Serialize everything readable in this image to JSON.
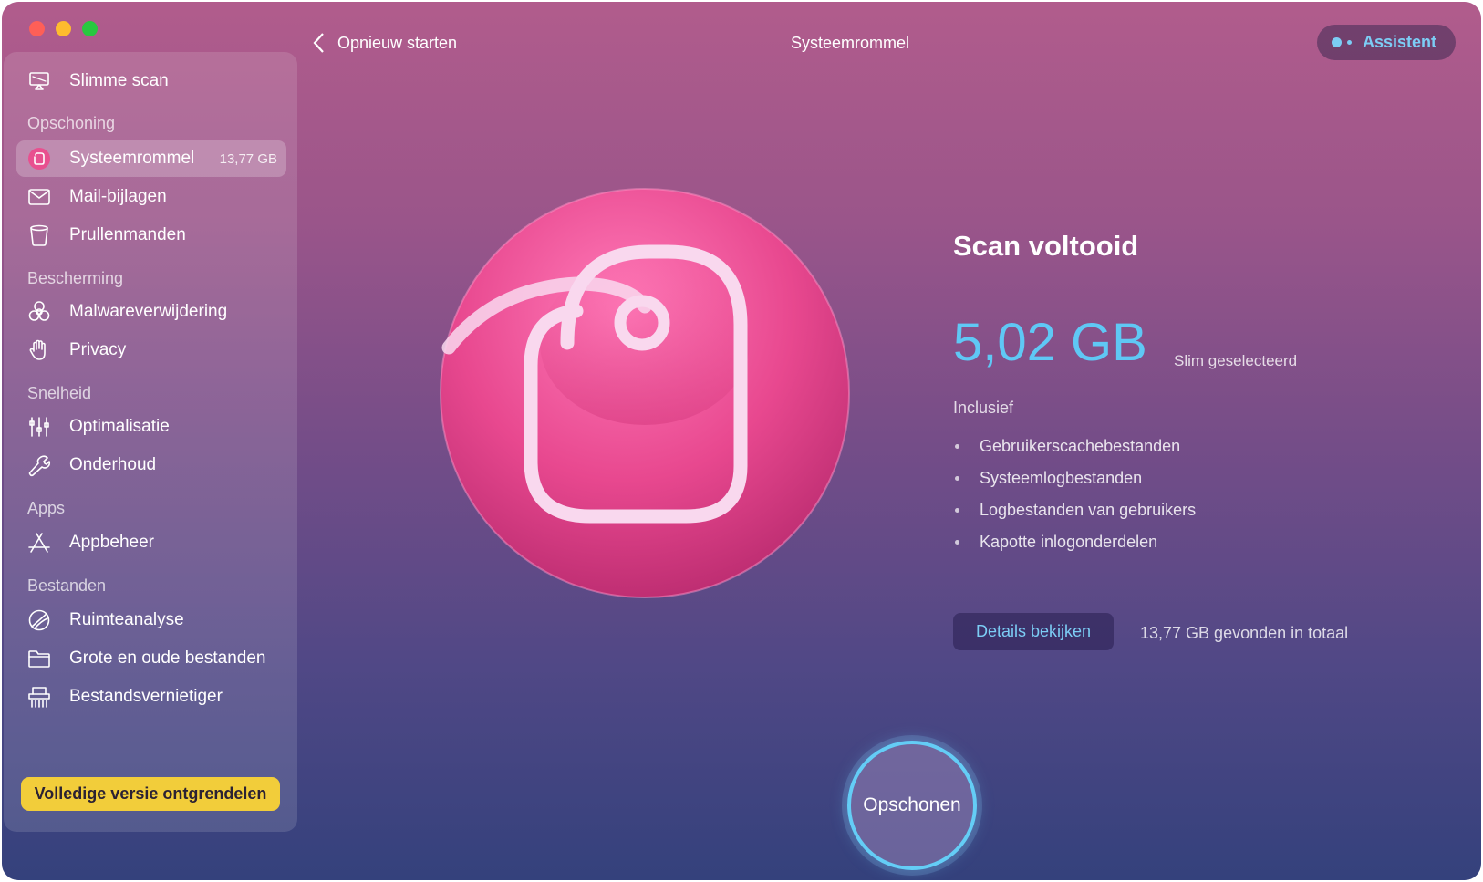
{
  "window": {
    "traffic_lights": [
      "close",
      "minimize",
      "zoom"
    ]
  },
  "topbar": {
    "back_label": "Opnieuw starten",
    "title": "Systeemrommel",
    "assistant_label": "Assistent"
  },
  "sidebar": {
    "smart_scan": "Slimme scan",
    "sections": {
      "cleanup": "Opschoning",
      "protection": "Bescherming",
      "speed": "Snelheid",
      "apps": "Apps",
      "files": "Bestanden"
    },
    "items": {
      "system_junk": {
        "label": "Systeemrommel",
        "size": "13,77 GB"
      },
      "mail_attachments": "Mail-bijlagen",
      "trash_bins": "Prullenmanden",
      "malware_removal": "Malwareverwijdering",
      "privacy": "Privacy",
      "optimization": "Optimalisatie",
      "maintenance": "Onderhoud",
      "app_manager": "Appbeheer",
      "space_lens": "Ruimteanalyse",
      "large_old_files": "Grote en oude bestanden",
      "shredder": "Bestandsvernietiger"
    },
    "unlock_label": "Volledige versie ontgrendelen"
  },
  "main": {
    "scan_title": "Scan voltooid",
    "selected_size": "5,02 GB",
    "selected_label": "Slim geselecteerd",
    "including_label": "Inclusief",
    "included_items": [
      "Gebruikerscachebestanden",
      "Systeemlogbestanden",
      "Logbestanden van gebruikers",
      "Kapotte inlogonderdelen"
    ],
    "details_label": "Details bekijken",
    "total_text": "13,77 GB gevonden in totaal",
    "clean_label": "Opschonen"
  },
  "colors": {
    "accent_blue": "#5fc8f5",
    "unlock_yellow": "#f2cd3a",
    "hero_pink": "#e94b94"
  }
}
